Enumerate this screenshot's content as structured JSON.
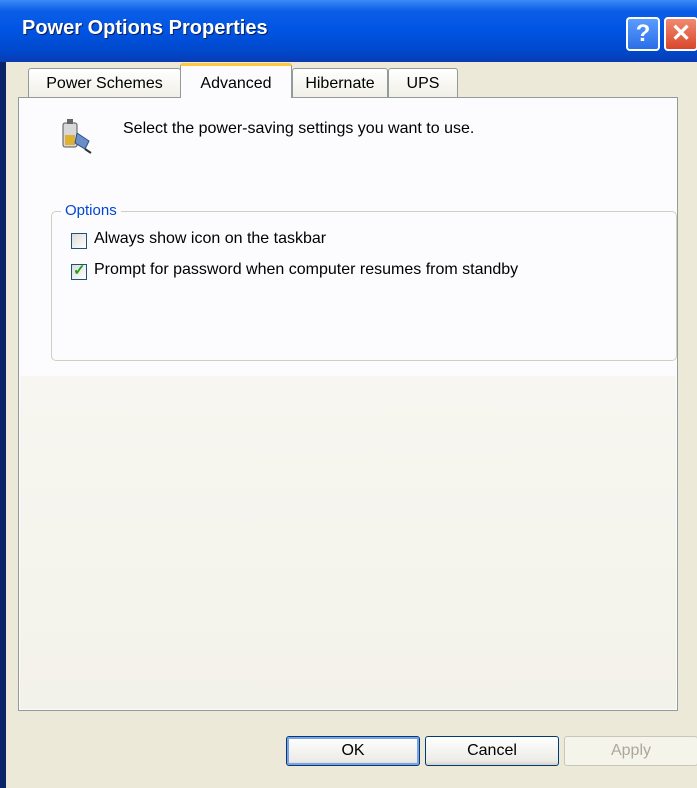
{
  "window": {
    "title": "Power Options Properties",
    "help_glyph": "?",
    "close_glyph": "✕"
  },
  "tabs": [
    {
      "label": "Power Schemes",
      "active": false
    },
    {
      "label": "Advanced",
      "active": true
    },
    {
      "label": "Hibernate",
      "active": false
    },
    {
      "label": "UPS",
      "active": false
    }
  ],
  "panel": {
    "icon": "battery-power-icon",
    "description": "Select the power-saving settings you want to use."
  },
  "options": {
    "label": "Options",
    "items": [
      {
        "label": "Always show icon on the taskbar",
        "checked": false
      },
      {
        "label": "Prompt for password when computer resumes from standby",
        "checked": true
      }
    ]
  },
  "buttons": {
    "ok": "OK",
    "cancel": "Cancel",
    "apply": "Apply"
  },
  "colors": {
    "title_bar": "#0054e3",
    "dialog_bg": "#ece9d8",
    "group_label": "#0046d5",
    "active_tab_accent": "#ffc83c"
  }
}
